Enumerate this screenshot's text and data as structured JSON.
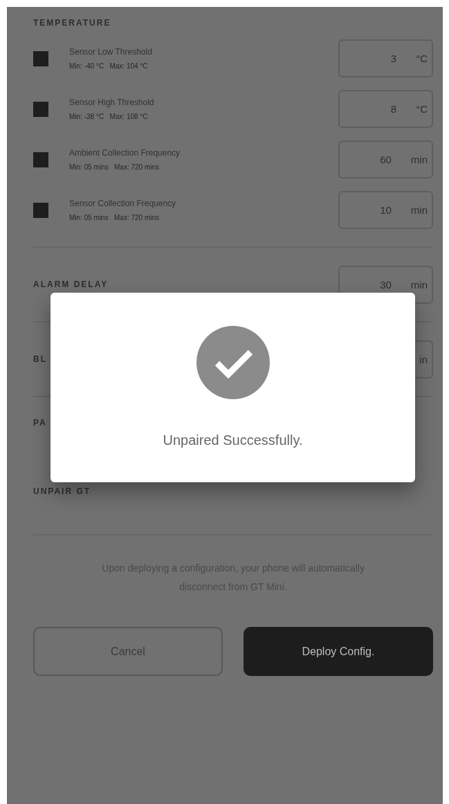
{
  "temperature": {
    "heading": "TEMPERATURE",
    "settings": [
      {
        "label": "Sensor Low Threshold",
        "range": "Min: -40 °C   Max: 104 °C",
        "value": "3",
        "unit": "°C"
      },
      {
        "label": "Sensor High Threshold",
        "range": "Min: -38 °C   Max: 108 °C",
        "value": "8",
        "unit": "°C"
      },
      {
        "label": "Ambient Collection Frequency",
        "range": "Min: 05 mins   Max: 720 mins",
        "value": "60",
        "unit": "min"
      },
      {
        "label": "Sensor Collection Frequency",
        "range": "Min: 05 mins   Max: 720 mins",
        "value": "10",
        "unit": "min"
      }
    ]
  },
  "alarm_delay": {
    "heading": "ALARM DELAY",
    "value": "30",
    "unit": "min"
  },
  "section_3": {
    "heading": "BL",
    "unit": "in"
  },
  "section_4": {
    "heading": "PA"
  },
  "unpair": {
    "heading": "UNPAIR GT"
  },
  "notice": "Upon deploying a configuration, your phone will automatically disconnect from GT Mini.",
  "buttons": [
    {
      "label": "Cancel",
      "kind": "secondary"
    },
    {
      "label": "Deploy Config.",
      "kind": "primary"
    }
  ],
  "dialog": {
    "message": "Unpaired Successfully."
  }
}
